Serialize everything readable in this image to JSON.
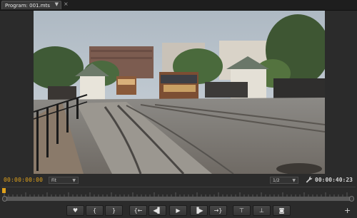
{
  "panel": {
    "tab_label": "Program: 001.mts",
    "tab_menu_glyph": "▼",
    "close_glyph": "×"
  },
  "footer": {
    "current_time": "00:00:00:00",
    "duration": "00:00:40:23",
    "zoom": {
      "value": "Fit",
      "caret": "▼"
    },
    "resolution": {
      "value": "1/2",
      "caret": "▼"
    },
    "playhead_position_fraction": 0.0
  },
  "transport": {
    "buttons": [
      {
        "name": "add-marker-button",
        "icon": "marker-icon",
        "glyph": "♥"
      },
      {
        "name": "mark-in-button",
        "icon": "mark-in-icon",
        "glyph": "{"
      },
      {
        "name": "mark-out-button",
        "icon": "mark-out-icon",
        "glyph": "}"
      },
      {
        "name": "go-to-in-button",
        "icon": "go-to-in-icon",
        "glyph": "{←"
      },
      {
        "name": "step-back-button",
        "icon": "step-back-icon",
        "glyph": "◀▌"
      },
      {
        "name": "play-button",
        "icon": "play-icon",
        "glyph": "▶"
      },
      {
        "name": "step-forward-button",
        "icon": "step-forward-icon",
        "glyph": "▐▶"
      },
      {
        "name": "go-to-out-button",
        "icon": "go-to-out-icon",
        "glyph": "→}"
      },
      {
        "name": "lift-button",
        "icon": "lift-icon",
        "glyph": "⊤"
      },
      {
        "name": "extract-button",
        "icon": "extract-icon",
        "glyph": "⊥"
      },
      {
        "name": "export-frame-button",
        "icon": "camera-icon",
        "glyph": "◙"
      }
    ],
    "add_button_glyph": "+"
  },
  "colors": {
    "timecode_active": "#e0a21b",
    "panel_bg": "#2b2b2b",
    "button_bg": "#404040"
  }
}
